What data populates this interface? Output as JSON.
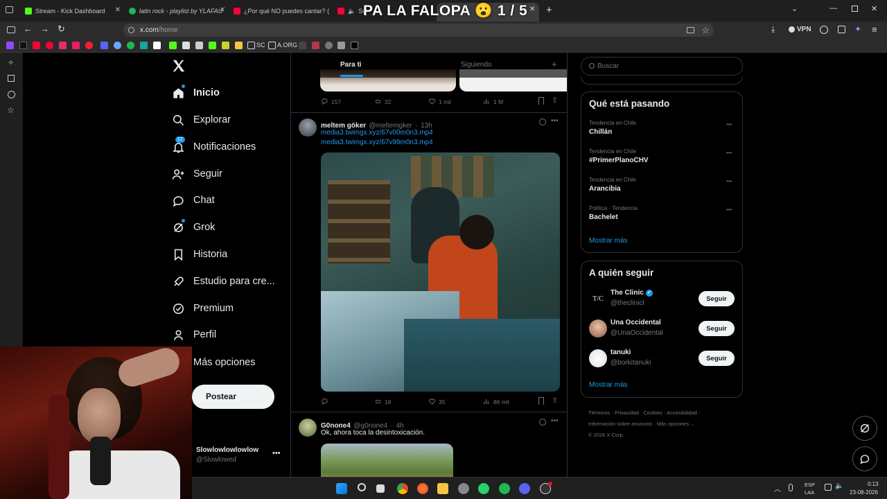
{
  "browser": {
    "tabs": [
      {
        "title": "Stream - Kick Dashboard",
        "color": "#53fc18"
      },
      {
        "title": "latin rock - playlist by YLAFAU",
        "color": "#1db954"
      },
      {
        "title": "¿Por qué NO puedes cantar? (s",
        "color": "#ff0033"
      },
      {
        "title": "So",
        "color": "#ff0033"
      },
      {
        "title": "x",
        "color": "#ffffff"
      }
    ],
    "overlay_title": "PA LA FALOPA 😮 1 / 5",
    "url_host": "x.com",
    "url_path": "/home",
    "vpn_label": "VPN",
    "bookmarks": [
      "SC",
      "A.ORG"
    ]
  },
  "nav": {
    "items": [
      {
        "label": "Inicio",
        "icon": "home-icon"
      },
      {
        "label": "Explorar",
        "icon": "search-icon"
      },
      {
        "label": "Notificaciones",
        "icon": "bell-icon",
        "badge": "17"
      },
      {
        "label": "Seguir",
        "icon": "add-person-icon"
      },
      {
        "label": "Chat",
        "icon": "chat-icon"
      },
      {
        "label": "Grok",
        "icon": "grok-icon"
      },
      {
        "label": "Historia",
        "icon": "bookmark-icon"
      },
      {
        "label": "Estudio para cre...",
        "icon": "rocket-icon"
      },
      {
        "label": "Premium",
        "icon": "premium-icon"
      },
      {
        "label": "Perfil",
        "icon": "person-icon"
      },
      {
        "label": "Más opciones",
        "icon": "more-icon"
      }
    ],
    "post_button": "Postear",
    "account_name": "Slowlowlowlowlow",
    "account_handle": "@Slowlowed"
  },
  "feed": {
    "tabs": [
      "Para ti",
      "Siguiendo"
    ],
    "top_actions": {
      "replies": "157",
      "reposts": "32",
      "likes": "1 mil",
      "views": "1 M"
    },
    "tweets": [
      {
        "name": "meltem göker",
        "handle": "@meltemgker",
        "time": "13h",
        "links": [
          "media3.twimgx.xyz/67v00m0n3.mp4",
          "media3.twimgx.xyz/67v99m0n3.mp4"
        ],
        "replies": "",
        "reposts": "18",
        "likes": "35",
        "views": "86 mil"
      },
      {
        "name": "G0none4",
        "handle": "@g0none4",
        "time": "4h",
        "text": "Ok, ahora toca la desintoxicación."
      }
    ]
  },
  "right": {
    "search_placeholder": "Buscar",
    "trends_title": "Qué está pasando",
    "trends": [
      {
        "context": "Tendencia en Chile",
        "name": "Chillán"
      },
      {
        "context": "Tendencia en Chile",
        "name": "#PrimerPlanoCHV"
      },
      {
        "context": "Tendencia en Chile",
        "name": "Arancibia"
      },
      {
        "context": "Política · Tendencia",
        "name": "Bachelet"
      }
    ],
    "show_more": "Mostrar más",
    "follow_title": "A quién seguir",
    "follow": [
      {
        "name": "The Clinic",
        "handle": "@theclinicl",
        "avatar": "T/C",
        "verified": true
      },
      {
        "name": "Una Occidental",
        "handle": "@UnaOccidental",
        "avatar": "",
        "verified": false
      },
      {
        "name": "tanuki",
        "handle": "@borkitanuki",
        "avatar": "",
        "verified": false
      }
    ],
    "follow_button": "Seguir",
    "show_more_2": "Mostrar más",
    "footer": [
      "Términos",
      "Privacidad",
      "Cookies",
      "Accesibilidad",
      "Información sobre anuncios",
      "Más opciones ...",
      "© 2026 X Corp."
    ]
  },
  "taskbar": {
    "lang": "ESP",
    "lang2": "LAA",
    "time": "0:13",
    "date": "23-08-2026"
  }
}
